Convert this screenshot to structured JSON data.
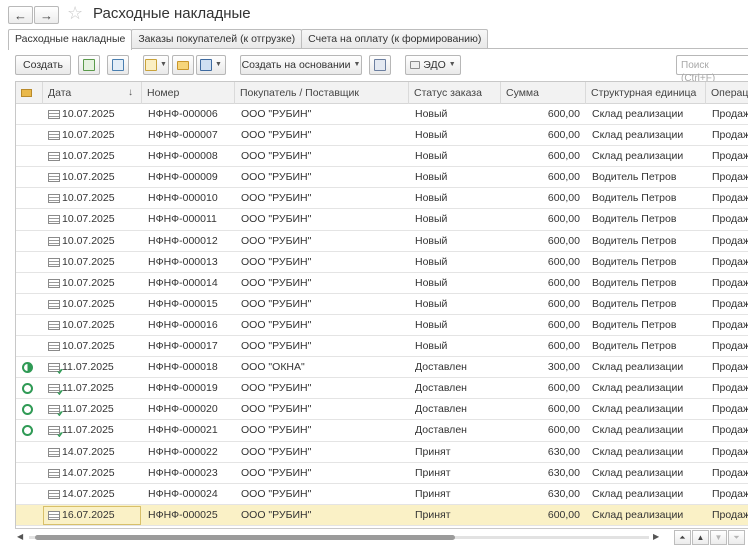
{
  "window": {
    "title": "Расходные накладные"
  },
  "tabs": [
    {
      "label": "Расходные накладные",
      "active": true
    },
    {
      "label": "Заказы покупателей (к отгрузке)",
      "active": false
    },
    {
      "label": "Счета на оплату (к формированию)",
      "active": false
    }
  ],
  "toolbar": {
    "create_label": "Создать",
    "create_based_label": "Создать на основании",
    "edo_label": "ЭДО",
    "search_placeholder": "Поиск (Ctrl+F)"
  },
  "table": {
    "columns": [
      "Дата",
      "Номер",
      "Покупатель / Поставщик",
      "Статус заказа",
      "Сумма",
      "Структурная единица",
      "Операц"
    ],
    "sort_indicator": "↓",
    "rows": [
      {
        "status": "",
        "posted": false,
        "date": "10.07.2025",
        "number": "НФНФ-000006",
        "partner": "ООО \"РУБИН\"",
        "order_status": "Новый",
        "sum": "600,00",
        "unit": "Склад реализации",
        "operation": "Продаж"
      },
      {
        "status": "",
        "posted": false,
        "date": "10.07.2025",
        "number": "НФНФ-000007",
        "partner": "ООО \"РУБИН\"",
        "order_status": "Новый",
        "sum": "600,00",
        "unit": "Склад реализации",
        "operation": "Продаж"
      },
      {
        "status": "",
        "posted": false,
        "date": "10.07.2025",
        "number": "НФНФ-000008",
        "partner": "ООО \"РУБИН\"",
        "order_status": "Новый",
        "sum": "600,00",
        "unit": "Склад реализации",
        "operation": "Продаж"
      },
      {
        "status": "",
        "posted": false,
        "date": "10.07.2025",
        "number": "НФНФ-000009",
        "partner": "ООО \"РУБИН\"",
        "order_status": "Новый",
        "sum": "600,00",
        "unit": "Водитель Петров",
        "operation": "Продаж"
      },
      {
        "status": "",
        "posted": false,
        "date": "10.07.2025",
        "number": "НФНФ-000010",
        "partner": "ООО \"РУБИН\"",
        "order_status": "Новый",
        "sum": "600,00",
        "unit": "Водитель Петров",
        "operation": "Продаж"
      },
      {
        "status": "",
        "posted": false,
        "date": "10.07.2025",
        "number": "НФНФ-000011",
        "partner": "ООО \"РУБИН\"",
        "order_status": "Новый",
        "sum": "600,00",
        "unit": "Водитель Петров",
        "operation": "Продаж"
      },
      {
        "status": "",
        "posted": false,
        "date": "10.07.2025",
        "number": "НФНФ-000012",
        "partner": "ООО \"РУБИН\"",
        "order_status": "Новый",
        "sum": "600,00",
        "unit": "Водитель Петров",
        "operation": "Продаж"
      },
      {
        "status": "",
        "posted": false,
        "date": "10.07.2025",
        "number": "НФНФ-000013",
        "partner": "ООО \"РУБИН\"",
        "order_status": "Новый",
        "sum": "600,00",
        "unit": "Водитель Петров",
        "operation": "Продаж"
      },
      {
        "status": "",
        "posted": false,
        "date": "10.07.2025",
        "number": "НФНФ-000014",
        "partner": "ООО \"РУБИН\"",
        "order_status": "Новый",
        "sum": "600,00",
        "unit": "Водитель Петров",
        "operation": "Продаж"
      },
      {
        "status": "",
        "posted": false,
        "date": "10.07.2025",
        "number": "НФНФ-000015",
        "partner": "ООО \"РУБИН\"",
        "order_status": "Новый",
        "sum": "600,00",
        "unit": "Водитель Петров",
        "operation": "Продаж"
      },
      {
        "status": "",
        "posted": false,
        "date": "10.07.2025",
        "number": "НФНФ-000016",
        "partner": "ООО \"РУБИН\"",
        "order_status": "Новый",
        "sum": "600,00",
        "unit": "Водитель Петров",
        "operation": "Продаж"
      },
      {
        "status": "",
        "posted": false,
        "date": "10.07.2025",
        "number": "НФНФ-000017",
        "partner": "ООО \"РУБИН\"",
        "order_status": "Новый",
        "sum": "600,00",
        "unit": "Водитель Петров",
        "operation": "Продаж"
      },
      {
        "status": "half",
        "posted": true,
        "date": "11.07.2025",
        "number": "НФНФ-000018",
        "partner": "ООО \"ОКНА\"",
        "order_status": "Доставлен",
        "sum": "300,00",
        "unit": "Склад реализации",
        "operation": "Продаж"
      },
      {
        "status": "ring",
        "posted": true,
        "date": "11.07.2025",
        "number": "НФНФ-000019",
        "partner": "ООО \"РУБИН\"",
        "order_status": "Доставлен",
        "sum": "600,00",
        "unit": "Склад реализации",
        "operation": "Продаж"
      },
      {
        "status": "ring",
        "posted": true,
        "date": "11.07.2025",
        "number": "НФНФ-000020",
        "partner": "ООО \"РУБИН\"",
        "order_status": "Доставлен",
        "sum": "600,00",
        "unit": "Склад реализации",
        "operation": "Продаж"
      },
      {
        "status": "ring",
        "posted": true,
        "date": "11.07.2025",
        "number": "НФНФ-000021",
        "partner": "ООО \"РУБИН\"",
        "order_status": "Доставлен",
        "sum": "600,00",
        "unit": "Склад реализации",
        "operation": "Продаж"
      },
      {
        "status": "",
        "posted": false,
        "date": "14.07.2025",
        "number": "НФНФ-000022",
        "partner": "ООО \"РУБИН\"",
        "order_status": "Принят",
        "sum": "630,00",
        "unit": "Склад реализации",
        "operation": "Продаж"
      },
      {
        "status": "",
        "posted": false,
        "date": "14.07.2025",
        "number": "НФНФ-000023",
        "partner": "ООО \"РУБИН\"",
        "order_status": "Принят",
        "sum": "630,00",
        "unit": "Склад реализации",
        "operation": "Продаж"
      },
      {
        "status": "",
        "posted": false,
        "date": "14.07.2025",
        "number": "НФНФ-000024",
        "partner": "ООО \"РУБИН\"",
        "order_status": "Принят",
        "sum": "630,00",
        "unit": "Склад реализации",
        "operation": "Продаж"
      },
      {
        "status": "",
        "posted": false,
        "date": "16.07.2025",
        "number": "НФНФ-000025",
        "partner": "ООО \"РУБИН\"",
        "order_status": "Принят",
        "sum": "600,00",
        "unit": "Склад реализации",
        "operation": "Продаж",
        "selected": true
      }
    ]
  },
  "colors": {
    "accent_green": "#2f9a55",
    "selected_row": "#faf1c6"
  }
}
